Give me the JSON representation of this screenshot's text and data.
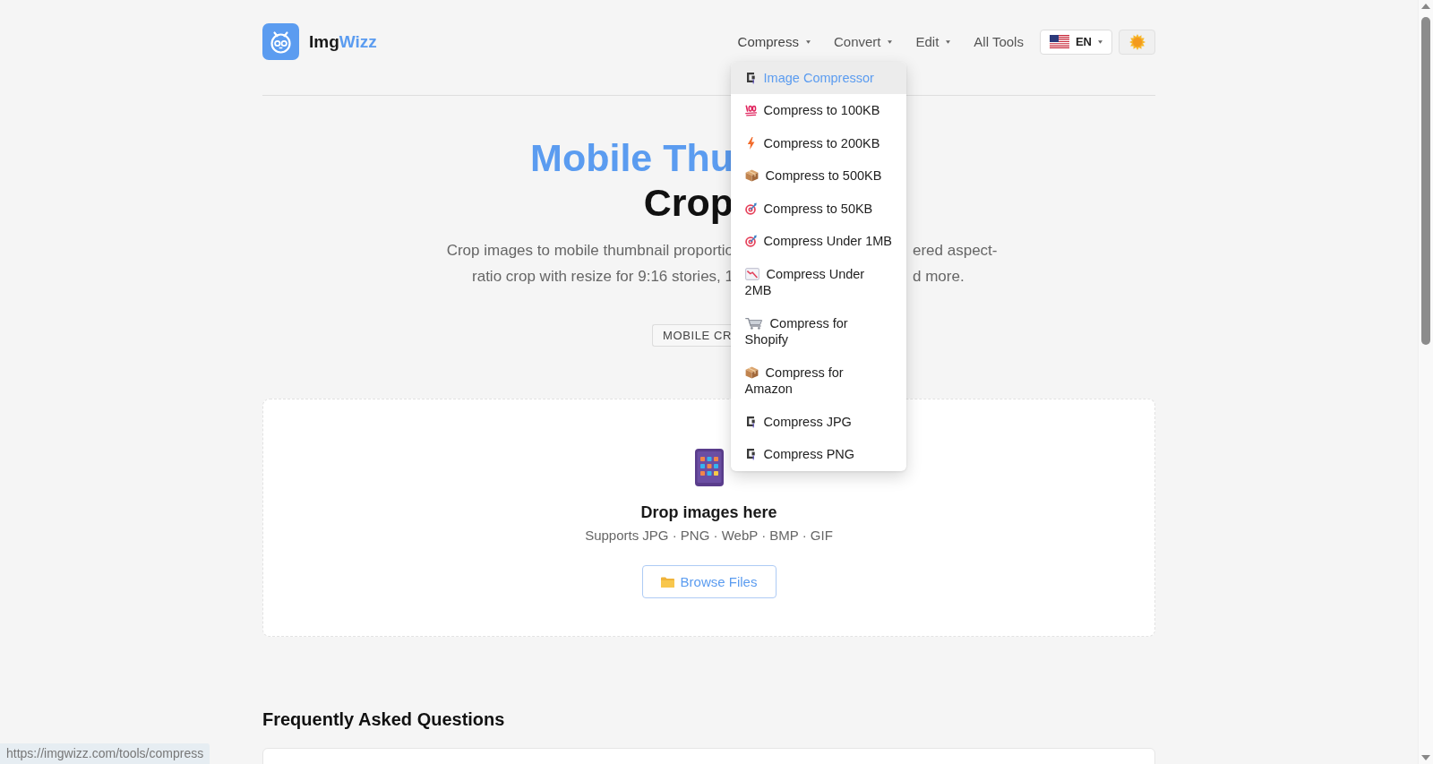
{
  "header": {
    "logo": {
      "text": "Img",
      "accent_text": "Wizz"
    },
    "nav": [
      {
        "label": "Compress",
        "has_menu": true,
        "expanded": true
      },
      {
        "label": "Convert",
        "has_menu": true,
        "expanded": false
      },
      {
        "label": "Edit",
        "has_menu": true,
        "expanded": false
      },
      {
        "label": "All Tools",
        "has_menu": false,
        "expanded": false
      }
    ],
    "language": {
      "label": "EN"
    }
  },
  "dropdown": {
    "items": [
      {
        "kind": "clamp",
        "label": "Image Compressor",
        "selected": true
      },
      {
        "kind": "hundred",
        "label": "Compress to 100KB",
        "selected": false
      },
      {
        "kind": "bolt",
        "label": "Compress to 200KB",
        "selected": false
      },
      {
        "kind": "package",
        "label": "Compress to 500KB",
        "selected": false
      },
      {
        "kind": "target",
        "label": "Compress to 50KB",
        "selected": false
      },
      {
        "kind": "target",
        "label": "Compress Under 1MB",
        "selected": false
      },
      {
        "kind": "chart",
        "label": "Compress Under 2MB",
        "selected": false
      },
      {
        "kind": "cart",
        "label": "Compress for Shopify",
        "selected": false
      },
      {
        "kind": "package",
        "label": "Compress for Amazon",
        "selected": false
      },
      {
        "kind": "clamp",
        "label": "Compress JPG",
        "selected": false
      },
      {
        "kind": "clamp",
        "label": "Compress PNG",
        "selected": false
      }
    ]
  },
  "hero": {
    "title_line_1": "Mobile Thu",
    "title_line_2": "Crop",
    "subtitle_lines": [
      {
        "left": "Crop images to mobile thumbnail proportio",
        "right": "ered aspect-"
      },
      {
        "left": "ratio crop with resize for 9:16 stories, 1",
        "right": "d more."
      }
    ],
    "badge": "MOBILE CR"
  },
  "upload": {
    "title": "Drop images here",
    "formats": "Supports JPG · PNG · WebP · BMP · GIF",
    "button": "Browse Files"
  },
  "faq": {
    "heading": "Frequently Asked Questions"
  },
  "status_bar": {
    "url": "https://imgwizz.com/tools/compress"
  }
}
